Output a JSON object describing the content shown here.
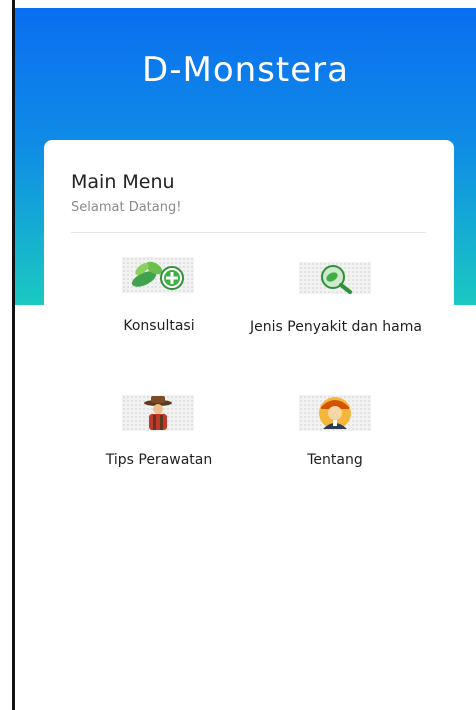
{
  "app": {
    "title": "D-Monstera"
  },
  "main_menu": {
    "title": "Main Menu",
    "subtitle": "Selamat Datang!",
    "items": [
      {
        "label": "Konsultasi",
        "icon": "plant-plus-icon"
      },
      {
        "label": "Jenis Penyakit dan hama",
        "icon": "leaf-search-icon"
      },
      {
        "label": "Tips Perawatan",
        "icon": "farmer-icon"
      },
      {
        "label": "Tentang",
        "icon": "profile-avatar-icon"
      }
    ]
  },
  "colors": {
    "header_gradient_top": "#0a6ef0",
    "header_gradient_bottom": "#1ac9c2",
    "card_background": "#ffffff",
    "accent_green": "#3cb043"
  }
}
